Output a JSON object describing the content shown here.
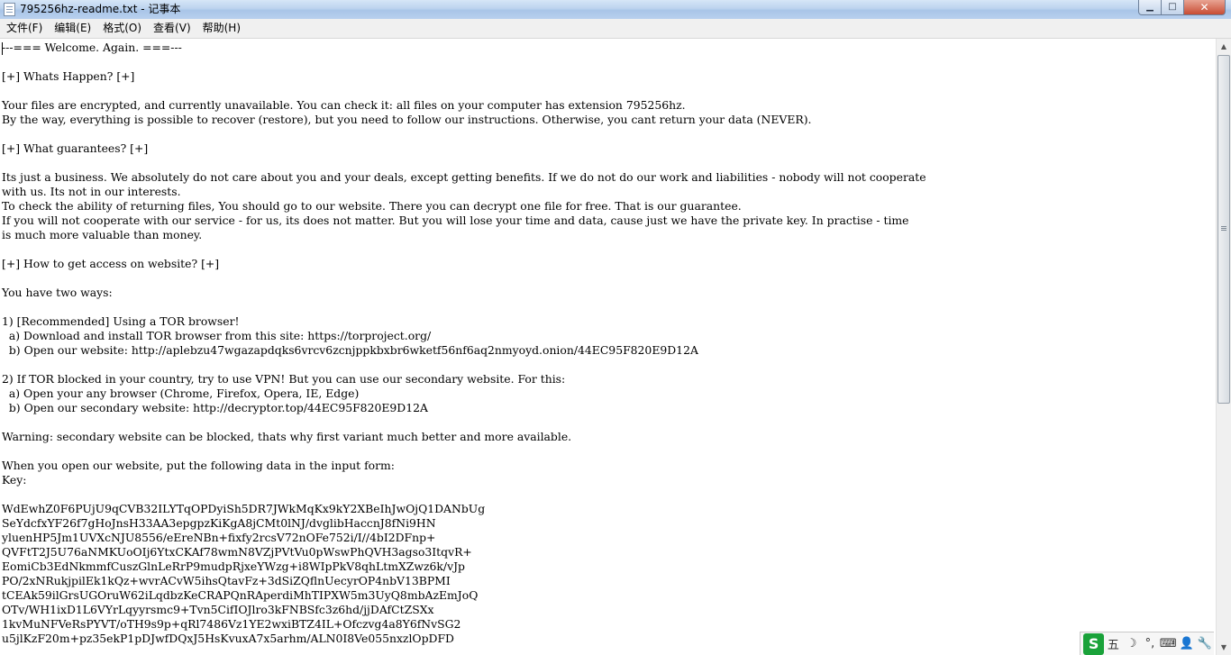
{
  "window": {
    "title": "795256hz-readme.txt - 记事本"
  },
  "controls": {
    "minimize": "▁",
    "maximize": "□",
    "close": "✕"
  },
  "menu": [
    "文件(F)",
    "编辑(E)",
    "格式(O)",
    "查看(V)",
    "帮助(H)"
  ],
  "document": {
    "content": "---=== Welcome. Again. ===---\n\n[+] Whats Happen? [+]\n\nYour files are encrypted, and currently unavailable. You can check it: all files on your computer has extension 795256hz.\nBy the way, everything is possible to recover (restore), but you need to follow our instructions. Otherwise, you cant return your data (NEVER).\n\n[+] What guarantees? [+]\n\nIts just a business. We absolutely do not care about you and your deals, except getting benefits. If we do not do our work and liabilities - nobody will not cooperate\nwith us. Its not in our interests.\nTo check the ability of returning files, You should go to our website. There you can decrypt one file for free. That is our guarantee.\nIf you will not cooperate with our service - for us, its does not matter. But you will lose your time and data, cause just we have the private key. In practise - time\nis much more valuable than money.\n\n[+] How to get access on website? [+]\n\nYou have two ways:\n\n1) [Recommended] Using a TOR browser!\n  a) Download and install TOR browser from this site: https://torproject.org/\n  b) Open our website: http://aplebzu47wgazapdqks6vrcv6zcnjppkbxbr6wketf56nf6aq2nmyoyd.onion/44EC95F820E9D12A\n\n2) If TOR blocked in your country, try to use VPN! But you can use our secondary website. For this:\n  a) Open your any browser (Chrome, Firefox, Opera, IE, Edge)\n  b) Open our secondary website: http://decryptor.top/44EC95F820E9D12A\n\nWarning: secondary website can be blocked, thats why first variant much better and more available.\n\nWhen you open our website, put the following data in the input form:\nKey:\n\nWdEwhZ0F6PUjU9qCVB32ILYTqOPDyiSh5DR7JWkMqKx9kY2XBeIhJwOjQ1DANbUg\nSeYdcfxYF26f7gHoJnsH33AA3epgpzKiKgA8jCMt0lNJ/dvglibHaccnJ8fNi9HN\nyluenHP5Jm1UVXcNJU8556/eEreNBn+fixfy2rcsV72nOFe752i/I//4bI2DFnp+\nQVFtT2J5U76aNMKUoOIj6YtxCKAf78wmN8VZjPVtVu0pWswPhQVH3agso3ItqvR+\nEomiCb3EdNkmmfCuszGlnLeRrP9mudpRjxeYWzg+i8WIpPkV8qhLtmXZwz6k/vJp\nPO/2xNRukjpilEk1kQz+wvrACvW5ihsQtavFz+3dSiZQflnUecyrOP4nbV13BPMI\ntCEAk59ilGrsUGOruW62iLqdbzKeCRAPQnRAperdiMhTIPXW5m3UyQ8mbAzEmJoQ\nOTv/WH1ixD1L6VYrLqyyrsmc9+Tvn5CifIOJlro3kFNBSfc3z6hd/jjDAfCtZSXx\n1kvMuNFVeRsPYVT/oTH9s9p+qRl7486Vz1YE2wxiBTZ4IL+Ofczvg4a8Y6fNvSG2\nu5jlKzF20m+pz35ekP1pDJwfDQxJ5HsKvuxA7x5arhm/ALN0I8Ve055nxzlOpDFD"
  },
  "ime": {
    "mode": "五",
    "items": [
      "☽",
      "°,",
      "⌨",
      "👤",
      "🔧"
    ]
  }
}
